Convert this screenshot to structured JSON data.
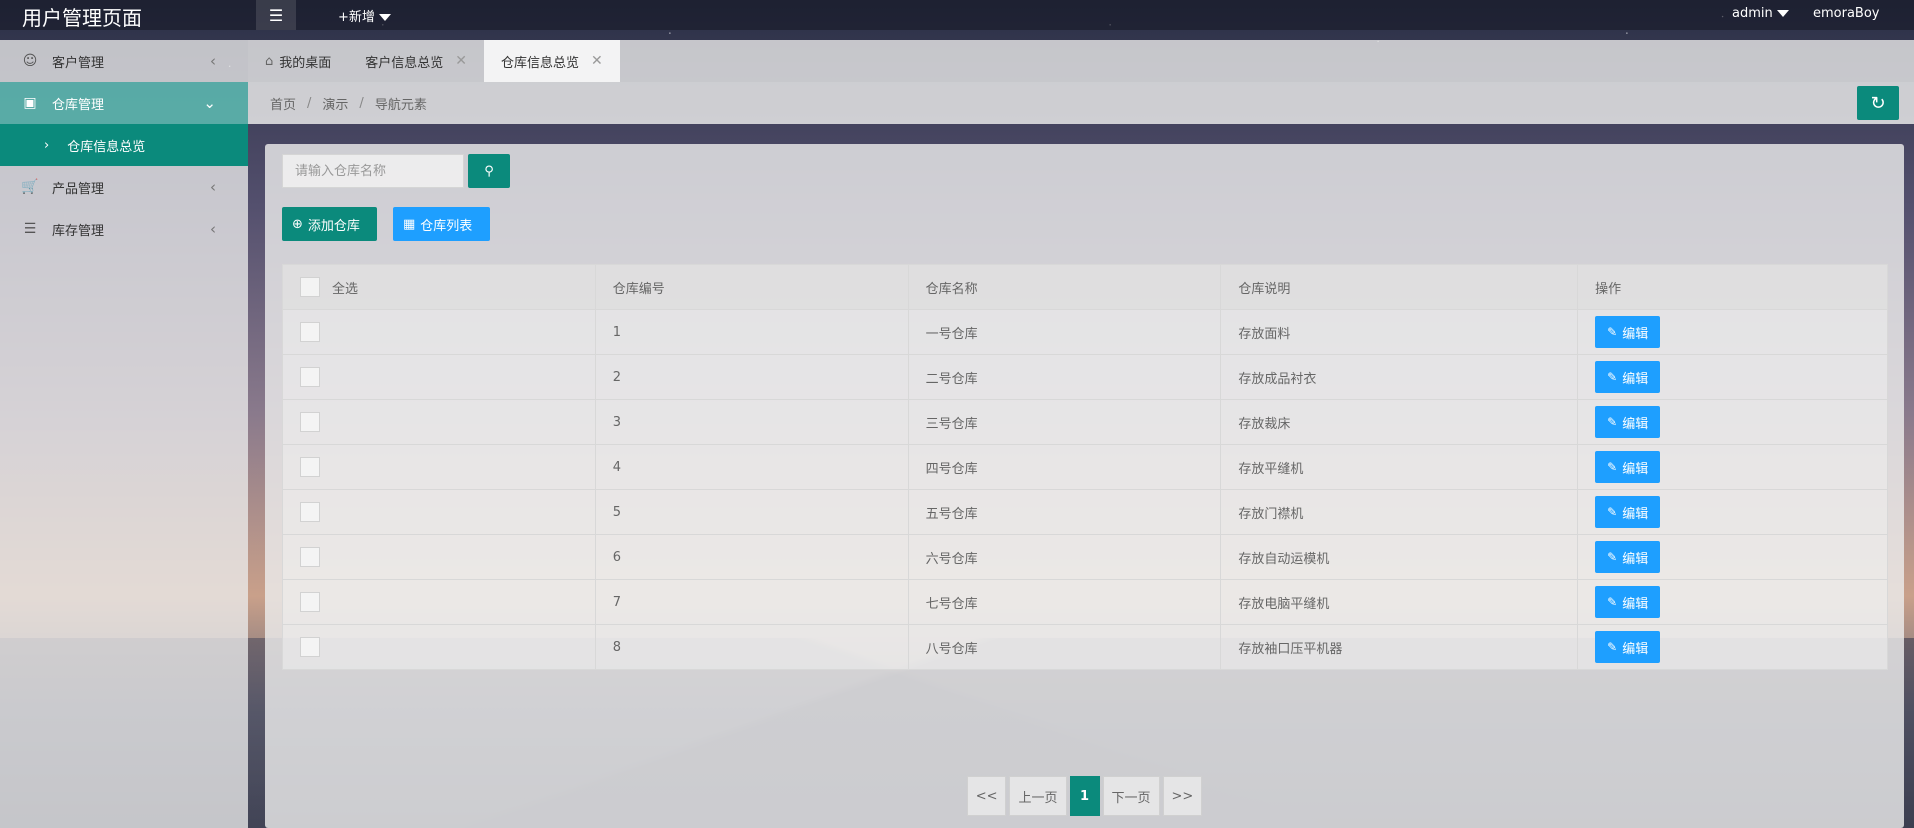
{
  "app": {
    "title": "用户管理页面",
    "new_label": "+新增",
    "user_menu": "admin",
    "username": "emoraBoy"
  },
  "sidebar": {
    "items": [
      {
        "label": "客户管理",
        "icon": "user-icon"
      },
      {
        "label": "仓库管理",
        "icon": "warehouse-icon",
        "active": true
      },
      {
        "label": "产品管理",
        "icon": "cart-icon"
      },
      {
        "label": "库存管理",
        "icon": "database-icon"
      }
    ],
    "submenu": {
      "label": "仓库信息总览"
    }
  },
  "tabs": [
    {
      "label": "我的桌面"
    },
    {
      "label": "客户信息总览"
    },
    {
      "label": "仓库信息总览",
      "active": true
    }
  ],
  "breadcrumb": [
    "首页",
    "演示",
    "导航元素"
  ],
  "search": {
    "placeholder": "请输入仓库名称"
  },
  "toolbar": {
    "add_label": "添加仓库",
    "list_label": "仓库列表"
  },
  "table": {
    "headers": [
      "全选",
      "仓库编号",
      "仓库名称",
      "仓库说明",
      "操作"
    ],
    "edit_label": "编辑",
    "rows": [
      {
        "id": "1",
        "name": "一号仓库",
        "desc": "存放面料"
      },
      {
        "id": "2",
        "name": "二号仓库",
        "desc": "存放成品衬衣"
      },
      {
        "id": "3",
        "name": "三号仓库",
        "desc": "存放裁床"
      },
      {
        "id": "4",
        "name": "四号仓库",
        "desc": "存放平缝机"
      },
      {
        "id": "5",
        "name": "五号仓库",
        "desc": "存放门襟机"
      },
      {
        "id": "6",
        "name": "六号仓库",
        "desc": "存放自动运模机"
      },
      {
        "id": "7",
        "name": "七号仓库",
        "desc": "存放电脑平缝机"
      },
      {
        "id": "8",
        "name": "八号仓库",
        "desc": "存放袖口压平机器"
      }
    ]
  },
  "pagination": {
    "first": "<<",
    "prev": "上一页",
    "current": "1",
    "next": "下一页",
    "last": ">>"
  },
  "colors": {
    "primary": "#0b8a7c",
    "accent": "#1e9fff"
  }
}
